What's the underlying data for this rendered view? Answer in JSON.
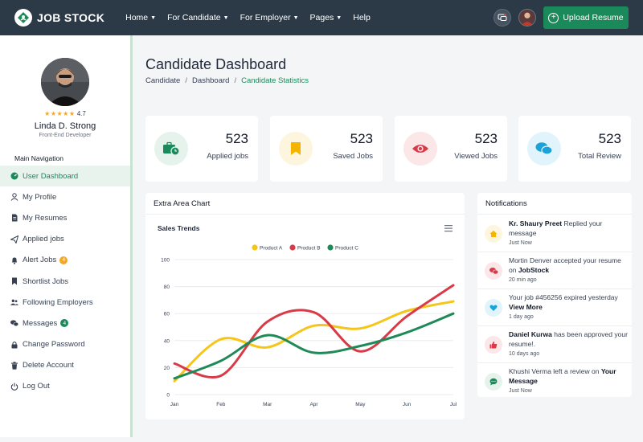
{
  "header": {
    "brand": "JOB STOCK",
    "nav": [
      {
        "label": "Home"
      },
      {
        "label": "For Candidate"
      },
      {
        "label": "For Employer"
      },
      {
        "label": "Pages"
      },
      {
        "label": "Help"
      }
    ],
    "upload_label": "Upload Resume"
  },
  "profile": {
    "rating": "4.7",
    "name": "Linda D. Strong",
    "role": "Front-End Developer"
  },
  "sidebar": {
    "heading": "Main Navigation",
    "items": [
      {
        "label": "User Dashboard",
        "icon": "dashboard-icon"
      },
      {
        "label": "My Profile",
        "icon": "user-icon"
      },
      {
        "label": "My Resumes",
        "icon": "document-icon"
      },
      {
        "label": "Applied jobs",
        "icon": "paper-plane-icon"
      },
      {
        "label": "Alert Jobs",
        "icon": "bell-icon",
        "badge": "4"
      },
      {
        "label": "Shortlist Jobs",
        "icon": "bookmark-icon"
      },
      {
        "label": "Following Employers",
        "icon": "users-icon"
      },
      {
        "label": "Messages",
        "icon": "comments-icon",
        "badge": "4"
      },
      {
        "label": "Change Password",
        "icon": "lock-icon"
      },
      {
        "label": "Delete Account",
        "icon": "trash-icon"
      },
      {
        "label": "Log Out",
        "icon": "power-icon"
      }
    ]
  },
  "main": {
    "title": "Candidate Dashboard",
    "breadcrumb": [
      "Candidate",
      "Dashboard",
      "Candidate Statistics"
    ]
  },
  "stats": [
    {
      "value": "523",
      "label": "Applied jobs",
      "icon": "briefcase-clock-icon",
      "color": "#1a8a5a",
      "bg": "#e5f3ec"
    },
    {
      "value": "523",
      "label": "Saved Jobs",
      "icon": "bookmark-icon",
      "color": "#f5b400",
      "bg": "#fdf5dd"
    },
    {
      "value": "523",
      "label": "Viewed Jobs",
      "icon": "eye-icon",
      "color": "#d93a47",
      "bg": "#fbe6e8"
    },
    {
      "value": "523",
      "label": "Total Review",
      "icon": "comments-icon",
      "color": "#1aa3d9",
      "bg": "#e1f4fb"
    }
  ],
  "chart_panel": {
    "title": "Extra Area Chart"
  },
  "chart_data": {
    "type": "line",
    "title": "Sales Trends",
    "categories": [
      "Jan",
      "Feb",
      "Mar",
      "Apr",
      "May",
      "Jun",
      "Jul"
    ],
    "ylim": [
      0,
      100
    ],
    "yticks": [
      0,
      20,
      40,
      60,
      80,
      100
    ],
    "grid": true,
    "legend": "top",
    "series": [
      {
        "name": "Product A",
        "color": "#f5c518",
        "values": [
          10,
          41,
          35,
          51,
          49,
          62,
          69
        ]
      },
      {
        "name": "Product B",
        "color": "#d93a47",
        "values": [
          23,
          14,
          54,
          61,
          32,
          58,
          81
        ]
      },
      {
        "name": "Product C",
        "color": "#1f8a57",
        "values": [
          12,
          25,
          44,
          31,
          36,
          46,
          60
        ]
      }
    ]
  },
  "notifications": {
    "title": "Notifications",
    "items": [
      {
        "bold_lead": "Kr. Shaury Preet",
        "text": " Replied your message",
        "bold_tail": "",
        "time": "Just Now",
        "icon": "home-icon",
        "color": "#f5b400",
        "bg": "#fdf5dd"
      },
      {
        "bold_lead": "",
        "text": "Mortin Denver accepted your resume on ",
        "bold_tail": "JobStock",
        "time": "20 min ago",
        "icon": "comments-icon",
        "color": "#d93a47",
        "bg": "#fbe6e8"
      },
      {
        "bold_lead": "",
        "text": "Your job #456256 expired yesterday ",
        "bold_tail": "View More",
        "time": "1 day ago",
        "icon": "heart-icon",
        "color": "#1aa3d9",
        "bg": "#e1f4fb"
      },
      {
        "bold_lead": "Daniel Kurwa",
        "text": " has been approved your resume!.",
        "bold_tail": "",
        "time": "10 days ago",
        "icon": "thumbs-up-icon",
        "color": "#d93a47",
        "bg": "#fbe6e8"
      },
      {
        "bold_lead": "",
        "text": "Khushi Verma left a review on ",
        "bold_tail": "Your Message",
        "time": "Just Now",
        "icon": "message-icon",
        "color": "#1a8a5a",
        "bg": "#e5f3ec"
      }
    ]
  }
}
